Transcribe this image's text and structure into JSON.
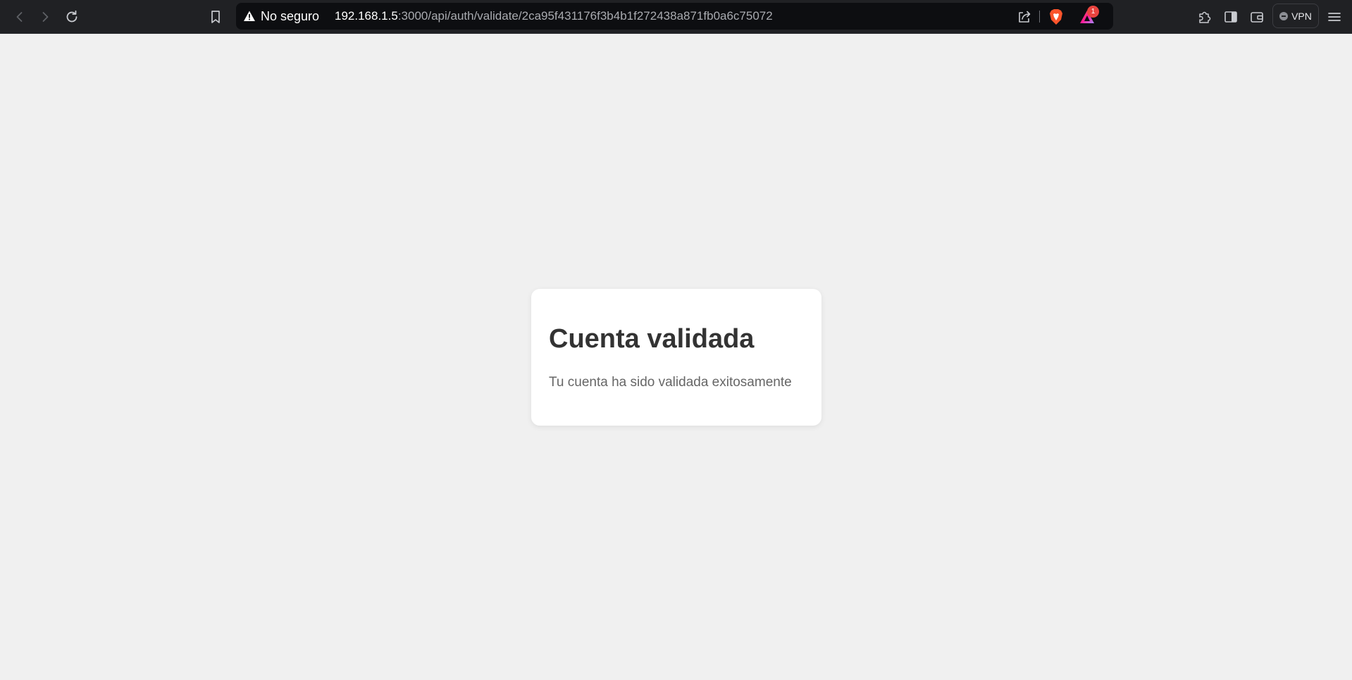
{
  "browser": {
    "security_label": "No seguro",
    "url_host": "192.168.1.5",
    "url_rest": ":3000/api/auth/validate/2ca95f431176f3b4b1f272438a871fb0a6c75072",
    "rewards_badge": "1",
    "vpn_label": "VPN",
    "icons": [
      "back-icon",
      "forward-icon",
      "reload-icon",
      "bookmark-icon",
      "warning-icon",
      "share-icon",
      "brave-shields-icon",
      "brave-rewards-icon",
      "extensions-icon",
      "sidebar-icon",
      "wallet-icon",
      "menu-icon"
    ]
  },
  "page": {
    "title": "Cuenta validada",
    "message": "Tu cuenta ha sido validada exitosamente"
  },
  "colors": {
    "page_background": "#f0f0f0",
    "card_background": "#ffffff",
    "title_color": "#333333",
    "message_color": "#666666",
    "toolbar_background": "#202124"
  }
}
